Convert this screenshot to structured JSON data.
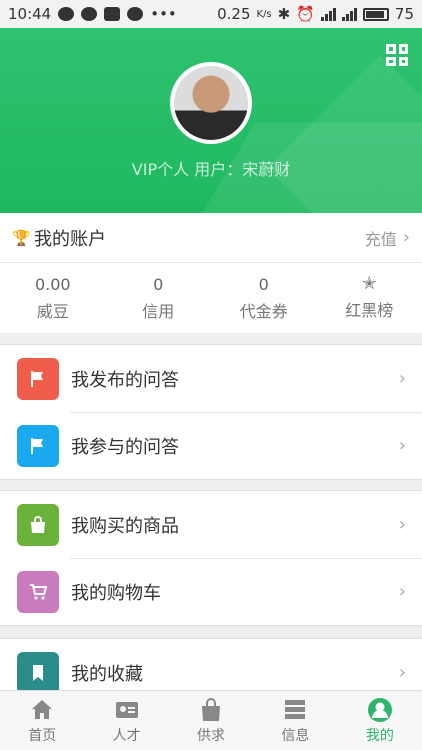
{
  "status_bar": {
    "time": "10:44",
    "net_speed": "0.25",
    "net_unit": "K/s",
    "battery": "75"
  },
  "header": {
    "user_line": "VIP个人 用户：宋蔚财"
  },
  "account": {
    "title": "我的账户",
    "recharge": "充值",
    "stats": [
      {
        "value": "0.00",
        "label": "威豆"
      },
      {
        "value": "0",
        "label": "信用"
      },
      {
        "value": "0",
        "label": "代金券"
      },
      {
        "label": "红黑榜"
      }
    ]
  },
  "menu": {
    "published_qa": "我发布的问答",
    "joined_qa": "我参与的问答",
    "purchased": "我购买的商品",
    "cart": "我的购物车",
    "favorites": "我的收藏"
  },
  "colors": {
    "brand_green": "#2db56a",
    "red": "#f05d4a",
    "blue": "#1aa9f0",
    "green": "#6bb23a",
    "pink": "#c97bbe",
    "teal": "#2a8d8a"
  },
  "bottom_nav": [
    {
      "label": "首页",
      "icon": "home-icon"
    },
    {
      "label": "人才",
      "icon": "id-card-icon"
    },
    {
      "label": "供求",
      "icon": "shopping-bag-icon"
    },
    {
      "label": "信息",
      "icon": "server-icon"
    },
    {
      "label": "我的",
      "icon": "user-icon"
    }
  ]
}
